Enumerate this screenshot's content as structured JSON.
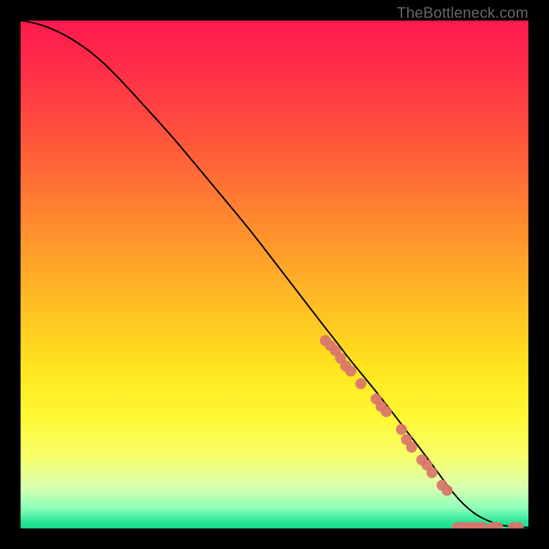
{
  "watermark": "TheBottleneck.com",
  "chart_data": {
    "type": "line",
    "title": "",
    "xlabel": "",
    "ylabel": "",
    "xlim": [
      0,
      100
    ],
    "ylim": [
      0,
      100
    ],
    "curve": {
      "name": "bottleneck-curve",
      "x": [
        0,
        3,
        6,
        10,
        15,
        20,
        25,
        30,
        35,
        40,
        45,
        50,
        55,
        60,
        62,
        65,
        70,
        75,
        80,
        84,
        86,
        88,
        90,
        92,
        94,
        96,
        98,
        100
      ],
      "y": [
        100,
        99.5,
        98.5,
        96.5,
        93,
        88,
        82.5,
        77,
        71,
        65,
        59,
        52.5,
        46,
        39.5,
        37,
        33,
        27,
        20.5,
        14,
        8.5,
        6,
        4,
        2.5,
        1.5,
        0.8,
        0.4,
        0.2,
        0.2
      ]
    },
    "scatter": {
      "name": "data-points",
      "color": "#d9746c",
      "radius": 8,
      "points": [
        {
          "x": 60,
          "y": 37
        },
        {
          "x": 61,
          "y": 36
        },
        {
          "x": 62,
          "y": 35
        },
        {
          "x": 63,
          "y": 33.5
        },
        {
          "x": 64,
          "y": 32
        },
        {
          "x": 65,
          "y": 31
        },
        {
          "x": 67,
          "y": 28.5
        },
        {
          "x": 70,
          "y": 25.5
        },
        {
          "x": 71,
          "y": 24
        },
        {
          "x": 72,
          "y": 23
        },
        {
          "x": 75,
          "y": 19.5
        },
        {
          "x": 76,
          "y": 17.5
        },
        {
          "x": 77,
          "y": 16
        },
        {
          "x": 79,
          "y": 13.5
        },
        {
          "x": 80,
          "y": 12.5
        },
        {
          "x": 81,
          "y": 11
        },
        {
          "x": 83,
          "y": 8.5
        },
        {
          "x": 84,
          "y": 7.5
        },
        {
          "x": 86,
          "y": 0.2
        },
        {
          "x": 87,
          "y": 0.2
        },
        {
          "x": 88,
          "y": 0.2
        },
        {
          "x": 89,
          "y": 0.2
        },
        {
          "x": 90,
          "y": 0.2
        },
        {
          "x": 91,
          "y": 0.2
        },
        {
          "x": 93,
          "y": 0.2
        },
        {
          "x": 94,
          "y": 0.2
        },
        {
          "x": 97,
          "y": 0.2
        },
        {
          "x": 98,
          "y": 0.2
        }
      ]
    },
    "background_gradient": {
      "stops": [
        {
          "offset": 0.0,
          "color": "#ff1a4f"
        },
        {
          "offset": 0.1,
          "color": "#ff2e48"
        },
        {
          "offset": 0.25,
          "color": "#ff5a3a"
        },
        {
          "offset": 0.4,
          "color": "#ff8b2e"
        },
        {
          "offset": 0.55,
          "color": "#ffbb24"
        },
        {
          "offset": 0.68,
          "color": "#ffe31e"
        },
        {
          "offset": 0.78,
          "color": "#fff833"
        },
        {
          "offset": 0.86,
          "color": "#f7ff6b"
        },
        {
          "offset": 0.92,
          "color": "#d8ffb0"
        },
        {
          "offset": 0.96,
          "color": "#8effba"
        },
        {
          "offset": 0.985,
          "color": "#2fe89a"
        },
        {
          "offset": 1.0,
          "color": "#17d98c"
        }
      ]
    }
  }
}
